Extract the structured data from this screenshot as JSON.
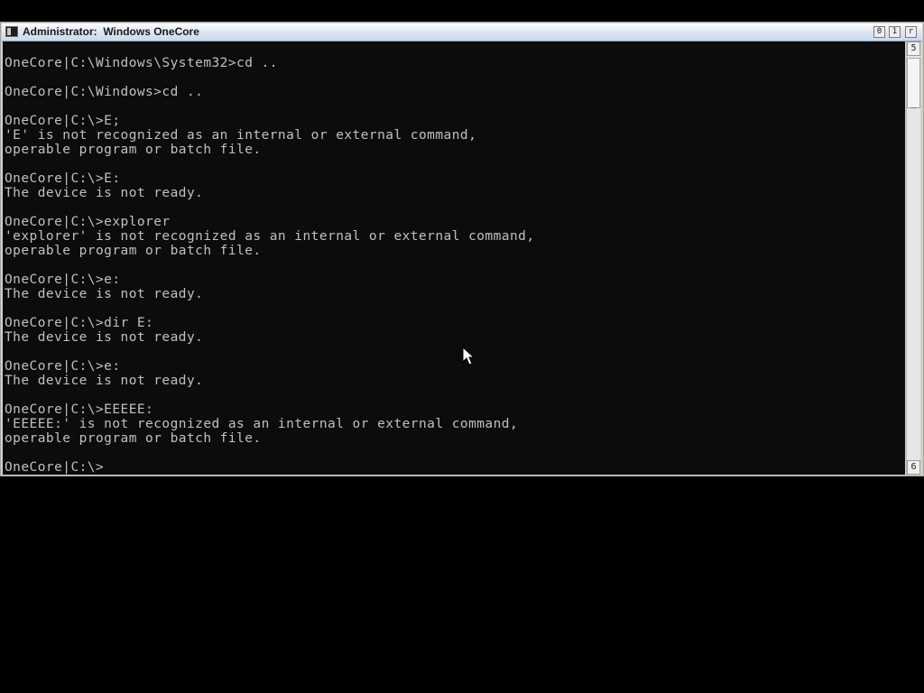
{
  "window": {
    "title": "Administrator:  Windows OneCore",
    "controls": {
      "minimize": "0",
      "maximize": "1",
      "close": "r"
    }
  },
  "scrollbar": {
    "up_arrow": "5",
    "down_arrow": "6"
  },
  "console": {
    "lines": [
      "OneCore|C:\\Windows\\System32>cd ..",
      "",
      "OneCore|C:\\Windows>cd ..",
      "",
      "OneCore|C:\\>E;",
      "'E' is not recognized as an internal or external command,",
      "operable program or batch file.",
      "",
      "OneCore|C:\\>E:",
      "The device is not ready.",
      "",
      "OneCore|C:\\>explorer",
      "'explorer' is not recognized as an internal or external command,",
      "operable program or batch file.",
      "",
      "OneCore|C:\\>e:",
      "The device is not ready.",
      "",
      "OneCore|C:\\>dir E:",
      "The device is not ready.",
      "",
      "OneCore|C:\\>e:",
      "The device is not ready.",
      "",
      "OneCore|C:\\>EEEEE:",
      "'EEEEE:' is not recognized as an internal or external command,",
      "operable program or batch file.",
      "",
      "OneCore|C:\\>"
    ]
  },
  "colors": {
    "console_background": "#0c0c0c",
    "console_text": "#c0c0c0",
    "desktop_background": "#000000"
  },
  "icons": {
    "window_icon": "console-window-icon",
    "pointer": "arrow-pointer-icon"
  }
}
